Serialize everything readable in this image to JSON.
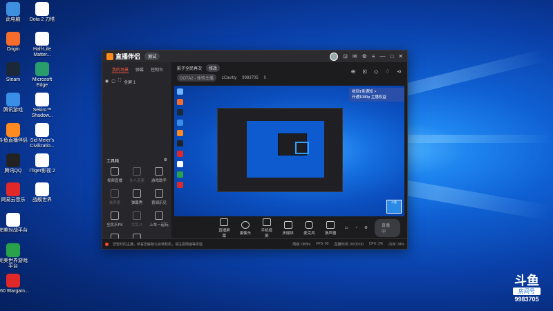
{
  "desktop": {
    "icons": [
      {
        "label": "此电脑",
        "color": "#3f8fe0"
      },
      {
        "label": "Dota 2 刀塔",
        "color": "#ffffff"
      },
      {
        "label": "Origin",
        "color": "#f56c2d"
      },
      {
        "label": "Half-Life Matter...",
        "color": "#ffffff"
      },
      {
        "label": "Steam",
        "color": "#1b2838"
      },
      {
        "label": "Microsoft Edge",
        "color": "#2a9d6c"
      },
      {
        "label": "腾讯游戏",
        "color": "#3a8ee6"
      },
      {
        "label": "Sekiro™ Shadow...",
        "color": "#ffffff"
      },
      {
        "label": "斗鱼直播伴侣",
        "color": "#ff8a1f"
      },
      {
        "label": "Sid Meier's Civilizatio...",
        "color": "#ffffff"
      },
      {
        "label": "腾讯QQ",
        "color": "#222222"
      },
      {
        "label": "ITiger影视 2",
        "color": "#ffffff"
      },
      {
        "label": "网易云音乐",
        "color": "#e02828"
      },
      {
        "label": "战舰世界",
        "color": "#ffffff"
      },
      {
        "label": "完美对战平台",
        "color": "#ffffff"
      },
      {
        "label": "完美世界游戏平台",
        "color": "#29a34a"
      },
      {
        "label": "360 Wargam...",
        "color": "#e02828"
      }
    ]
  },
  "app": {
    "logo_text": "直播伴侣",
    "version": "测试",
    "title_controls": [
      "☻",
      "⊡",
      "✉",
      "⚙",
      "≡",
      "—",
      "□",
      "✕"
    ],
    "left_tabs": [
      "我的场景",
      "弹幕",
      "控制台"
    ],
    "scene": {
      "name": "全屏 1"
    },
    "toolbox": {
      "title": "工具箱"
    },
    "tools": [
      {
        "label": "视频直播",
        "dim": false
      },
      {
        "label": "多人连麦",
        "dim": true
      },
      {
        "label": "游戏助手",
        "dim": false
      },
      {
        "label": "贵宾席",
        "dim": true
      },
      {
        "label": "弹幕秀",
        "dim": false
      },
      {
        "label": "喜闻乐见",
        "dim": false
      },
      {
        "label": "全民乐PK",
        "dim": false
      },
      {
        "label": "大乱斗",
        "dim": true
      },
      {
        "label": "上车一起玩",
        "dim": false
      },
      {
        "label": "福利社",
        "dim": false
      },
      {
        "label": "同屏PK",
        "dim": false
      }
    ],
    "room": {
      "title": "影子全民再次",
      "edit": "修改",
      "category": "DOTA2 - 体验主播",
      "streamer": "zCavitty",
      "room_id": "9983705",
      "hot": "0"
    },
    "notice": {
      "line1": "收到1条通知 >",
      "line2": "开通1080p 主播权益"
    },
    "controls": [
      "直播屏幕",
      "摄像头",
      "手机投屏",
      "多媒体",
      "麦克风",
      "扬声器"
    ],
    "go_live": "直播中",
    "status": {
      "warning": "您暂时的主播，恭喜您解锁公会特权机，请注意网速等体验",
      "stats": [
        "网络: 0KB/s",
        "FPS: 60",
        "直播时间: 00:00:00",
        "CPU: 2%",
        "内存: 34%"
      ]
    }
  },
  "watermark": {
    "logo": "斗鱼",
    "sub": "房间号",
    "number": "9983705"
  }
}
